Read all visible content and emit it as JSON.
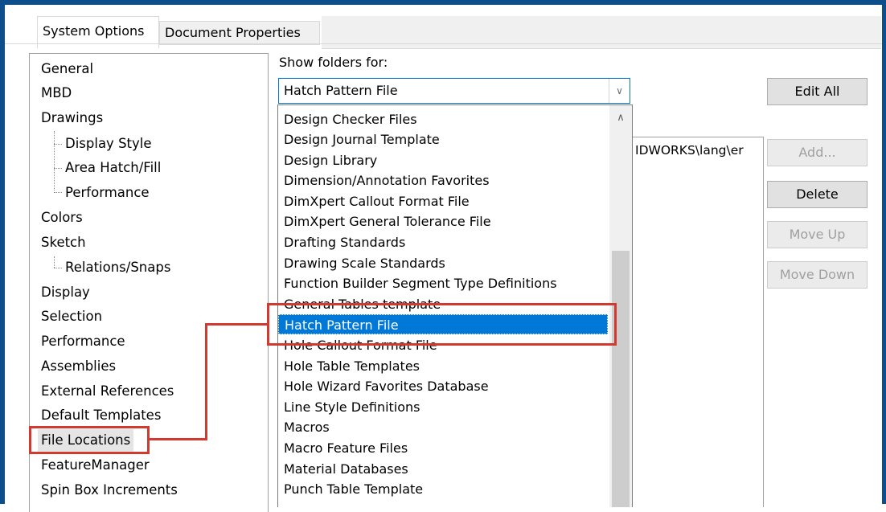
{
  "tabs": [
    {
      "label": "System Options",
      "selected": true
    },
    {
      "label": "Document Properties",
      "selected": false
    }
  ],
  "tree": {
    "items": [
      {
        "label": "General",
        "level": 0
      },
      {
        "label": "MBD",
        "level": 0
      },
      {
        "label": "Drawings",
        "level": 0
      },
      {
        "label": "Display Style",
        "level": 1
      },
      {
        "label": "Area Hatch/Fill",
        "level": 1
      },
      {
        "label": "Performance",
        "level": 1
      },
      {
        "label": "Colors",
        "level": 0
      },
      {
        "label": "Sketch",
        "level": 0
      },
      {
        "label": "Relations/Snaps",
        "level": 1
      },
      {
        "label": "Display",
        "level": 0
      },
      {
        "label": "Selection",
        "level": 0
      },
      {
        "label": "Performance",
        "level": 0
      },
      {
        "label": "Assemblies",
        "level": 0
      },
      {
        "label": "External References",
        "level": 0
      },
      {
        "label": "Default Templates",
        "level": 0
      },
      {
        "label": "File Locations",
        "level": 0,
        "selected": true
      },
      {
        "label": "FeatureManager",
        "level": 0
      },
      {
        "label": "Spin Box Increments",
        "level": 0
      }
    ]
  },
  "show_folders": {
    "label": "Show folders for:",
    "value": "Hatch Pattern File"
  },
  "folder_path": "IDWORKS\\lang\\er",
  "dropdown": {
    "items": [
      "Design Checker Files",
      "Design Journal Template",
      "Design Library",
      "Dimension/Annotation Favorites",
      "DimXpert Callout Format File",
      "DimXpert General Tolerance File",
      "Drafting Standards",
      "Drawing Scale Standards",
      "Function Builder Segment Type Definitions",
      "General Tables template",
      "Hatch Pattern File",
      "Hole Callout Format File",
      "Hole Table Templates",
      "Hole Wizard Favorites Database",
      "Line Style Definitions",
      "Macros",
      "Macro Feature Files",
      "Material Databases",
      "Punch Table Template"
    ],
    "selected": "Hatch Pattern File"
  },
  "buttons": {
    "edit_all": "Edit All",
    "add": "Add...",
    "delete": "Delete",
    "move_up": "Move Up",
    "move_down": "Move Down"
  },
  "colors": {
    "accent": "#0078d7",
    "frame": "#0d4f8b",
    "callout": "#d23a2f"
  }
}
